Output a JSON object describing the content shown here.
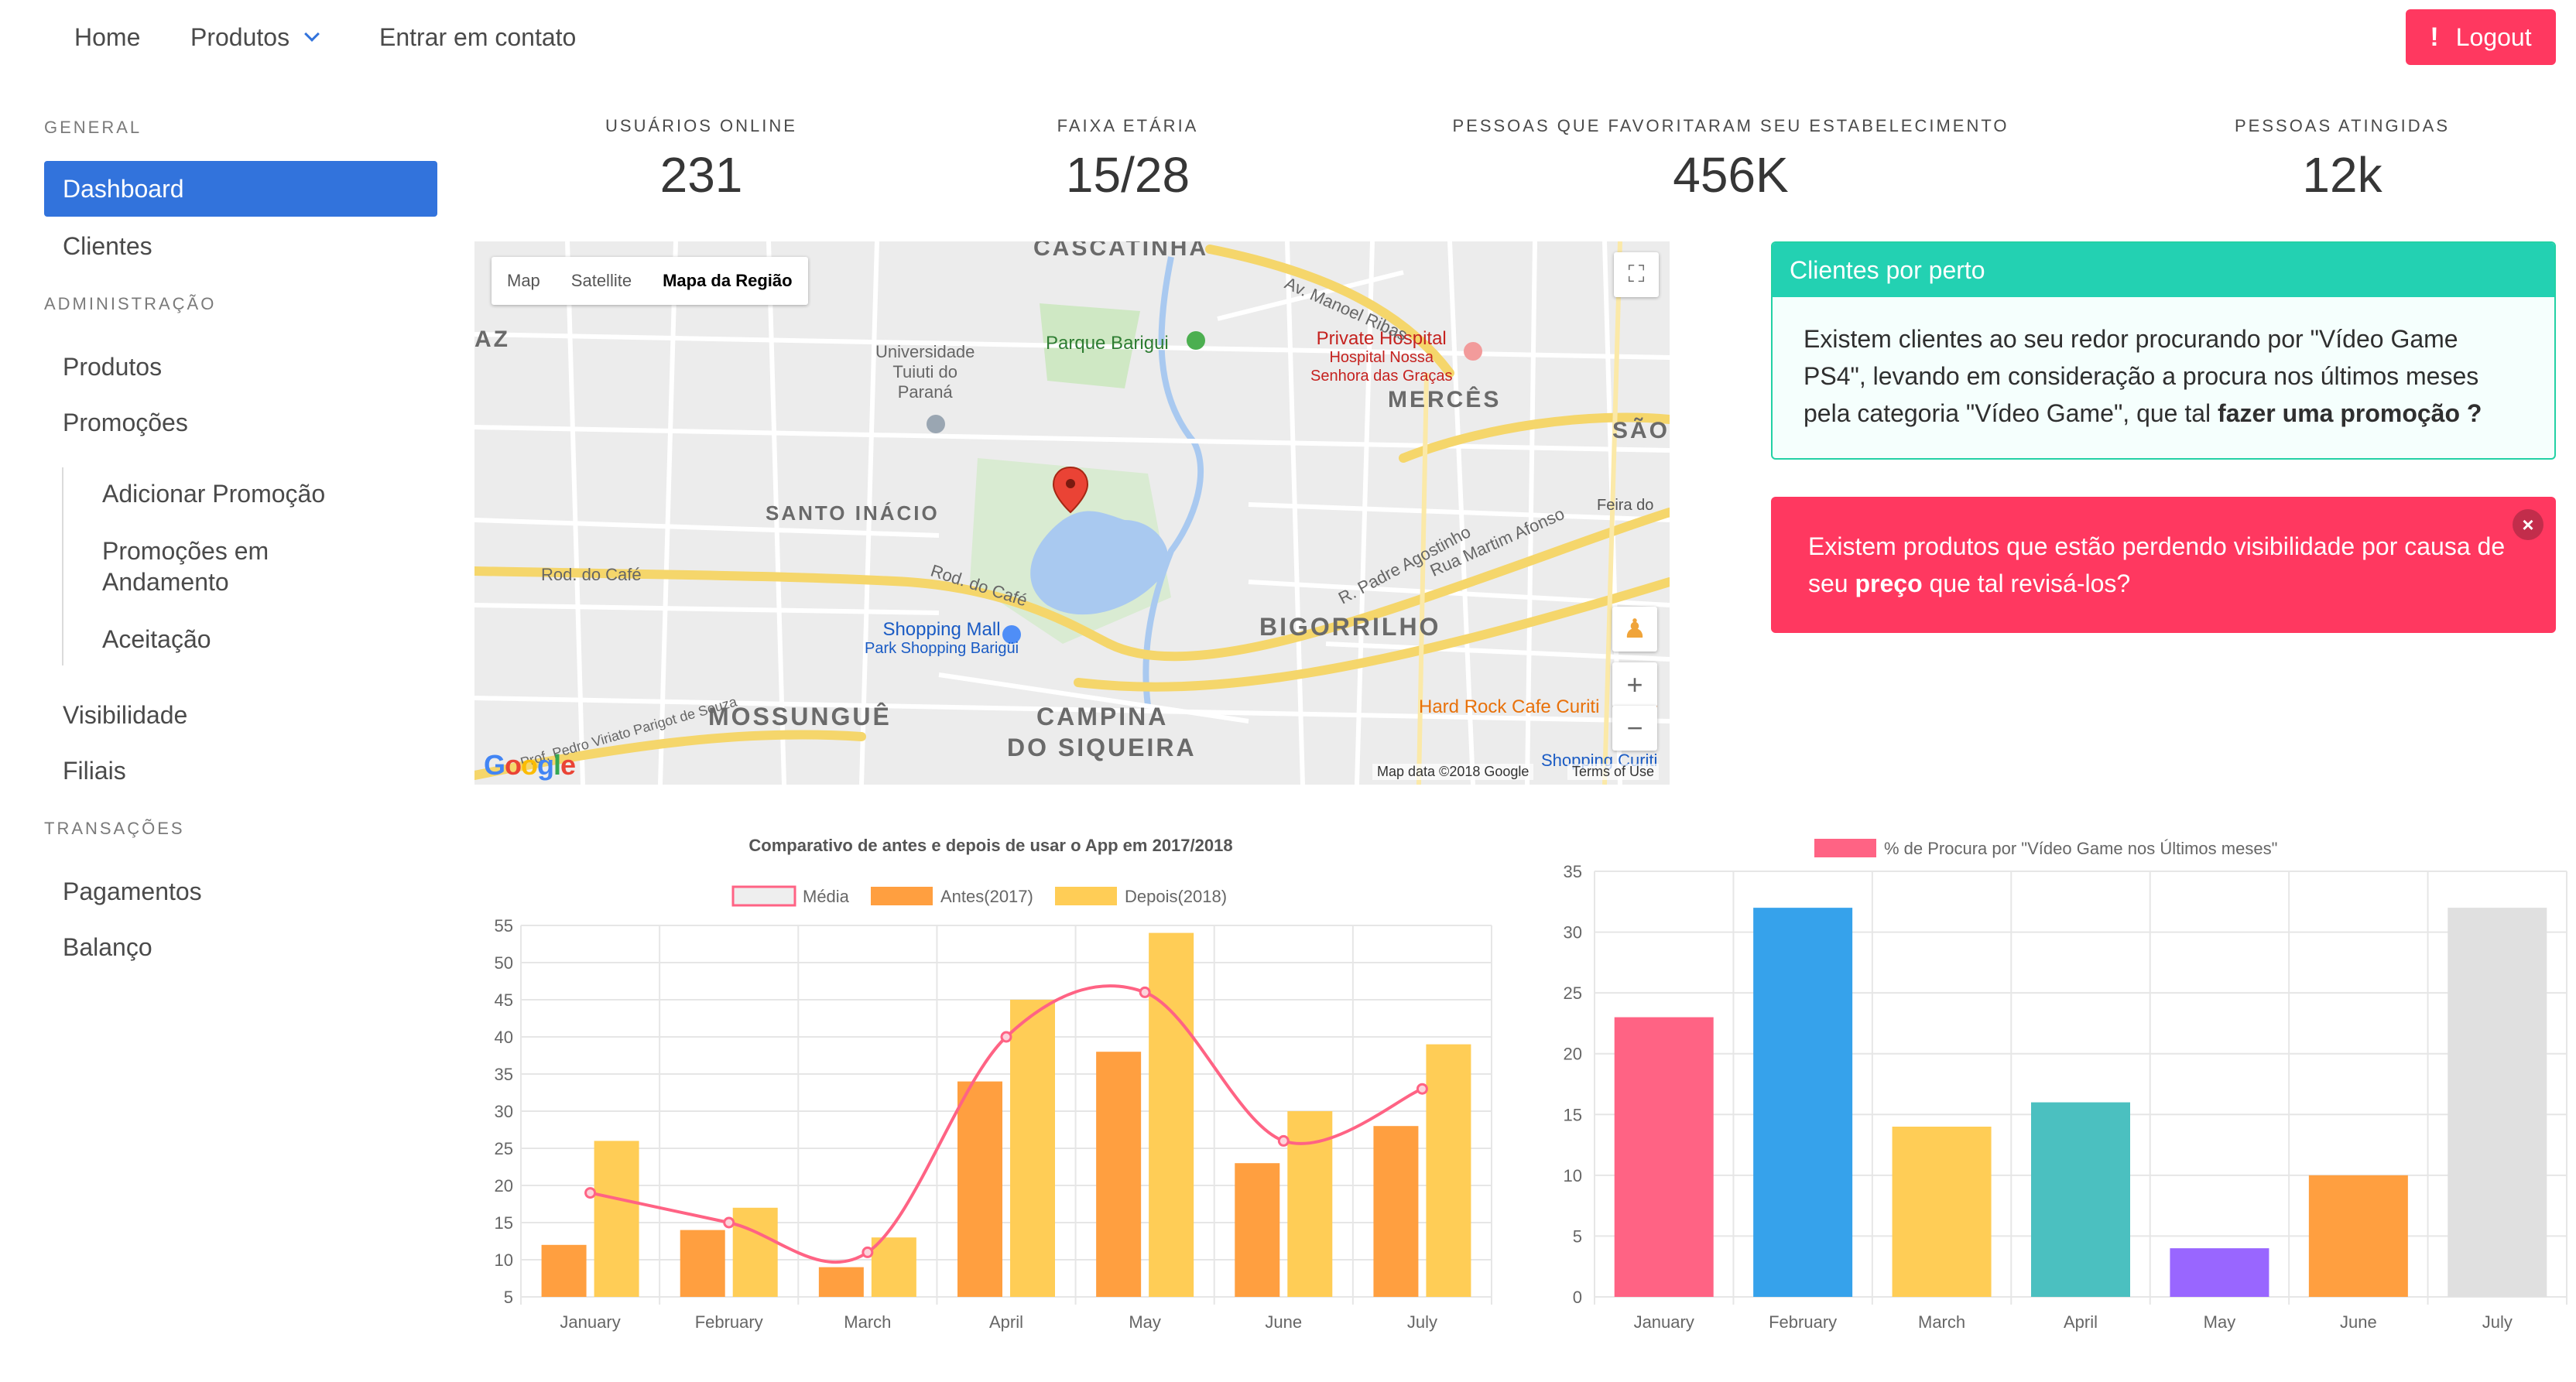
{
  "nav": {
    "home": "Home",
    "produtos": "Produtos",
    "contato": "Entrar em contato",
    "logout": "Logout",
    "logout_icon": "exclamation-icon"
  },
  "sidebar": {
    "general_label": "GENERAL",
    "dashboard": "Dashboard",
    "clientes": "Clientes",
    "admin_label": "ADMINISTRAÇÃO",
    "produtos": "Produtos",
    "promocoes": "Promoções",
    "sub": {
      "adicionar": "Adicionar Promoção",
      "andamento": "Promoções em Andamento",
      "aceitacao": "Aceitação"
    },
    "visibilidade": "Visibilidade",
    "filiais": "Filiais",
    "transacoes_label": "TRANSAÇÕES",
    "pagamentos": "Pagamentos",
    "balanco": "Balanço"
  },
  "stats": [
    {
      "heading": "USUÁRIOS ONLINE",
      "value": "231"
    },
    {
      "heading": "FAIXA ETÁRIA",
      "value": "15/28"
    },
    {
      "heading": "PESSOAS QUE FAVORITARAM SEU ESTABELECIMENTO",
      "value": "456K"
    },
    {
      "heading": "PESSOAS ATINGIDAS",
      "value": "12k"
    }
  ],
  "map": {
    "types": [
      "Map",
      "Satellite",
      "Mapa da Região"
    ],
    "selected_type": "Mapa da Região",
    "neighborhoods": {
      "santo_inacio": "SANTO INÁCIO",
      "merces": "MERCÊS",
      "bigorrilho": "BIGORRILHO",
      "mossungue": "MOSSUNGUÊ",
      "campina": "CAMPINA",
      "do_siqueira": "DO SIQUEIRA",
      "cascatinha": "CASCATINHA",
      "az": "AZ",
      "sao": "SÃO"
    },
    "places": {
      "universidade_1": "Universidade",
      "universidade_2": "Tuiuti do",
      "universidade_3": "Paraná",
      "parque": "Parque Barigui",
      "hospital_1": "Private Hospital",
      "hospital_2": "Hospital Nossa",
      "hospital_3": "Senhora das Graças",
      "shopping_1": "Shopping Mall",
      "shopping_2": "Park Shopping Barigüi",
      "hardrock": "Hard Rock Cafe Curiti",
      "feira": "Feira do",
      "shopping_curiti": "Shopping Curiti"
    },
    "streets": {
      "manoel_ribas": "Av. Manoel Ribas",
      "rod_cafe": "Rod. do Café",
      "rod_cafe_2": "Rod. do Café",
      "padre_agostinho": "R. Padre Agostinho",
      "martim_afonso": "Rua Martim Afonso",
      "pedro_viriato": "Prof. Pedro Viriato Parigot de Souza"
    },
    "footer_data": "Map data ©2018 Google",
    "footer_terms": "Terms of Use",
    "google": "Google"
  },
  "notifications": {
    "nearby_title": "Clientes por perto",
    "nearby_text": "Existem clientes ao seu redor procurando por \"Vídeo Game PS4\", levando em consideração a procura nos últimos meses pela categoria \"Vídeo Game\", que tal ",
    "nearby_bold": "fazer uma promoção ?",
    "alert_text_1": "Existem produtos que estão perdendo visibilidade por causa de seu ",
    "alert_bold": "preço",
    "alert_text_2": " que tal revisá-los?",
    "close_symbol": "×"
  },
  "chart_data": [
    {
      "type": "bar",
      "title": "Comparativo de antes e depois de usar o App em 2017/2018",
      "categories": [
        "January",
        "February",
        "March",
        "April",
        "May",
        "June",
        "July"
      ],
      "ylim": [
        5,
        55
      ],
      "yticks": [
        5,
        10,
        15,
        20,
        25,
        30,
        35,
        40,
        45,
        50,
        55
      ],
      "series": [
        {
          "name": "Média",
          "type": "line",
          "color": "#ff6384",
          "values": [
            19,
            15,
            11,
            40,
            46,
            26,
            33
          ]
        },
        {
          "name": "Antes(2017)",
          "type": "bar",
          "color": "#ff9f40",
          "values": [
            12,
            14,
            9,
            34,
            38,
            23,
            28
          ]
        },
        {
          "name": "Depois(2018)",
          "type": "bar",
          "color": "#ffcd56",
          "values": [
            26,
            17,
            13,
            45,
            54,
            30,
            39
          ]
        }
      ],
      "legend": "top",
      "grid": true
    },
    {
      "type": "bar",
      "categories": [
        "January",
        "February",
        "March",
        "April",
        "May",
        "June",
        "July"
      ],
      "ylim": [
        0,
        35
      ],
      "yticks": [
        0,
        5,
        10,
        15,
        20,
        25,
        30,
        35
      ],
      "series": [
        {
          "name": "% de Procura por \"Vídeo Game nos Últimos meses\"",
          "values": [
            23,
            32,
            14,
            16,
            4,
            10,
            32
          ]
        }
      ],
      "bar_colors": [
        "#ff6384",
        "#36a2eb",
        "#ffcd56",
        "#4bc0c0",
        "#9966ff",
        "#ff9f40",
        "#e0e0e0"
      ],
      "legend": "top",
      "grid": true
    }
  ]
}
